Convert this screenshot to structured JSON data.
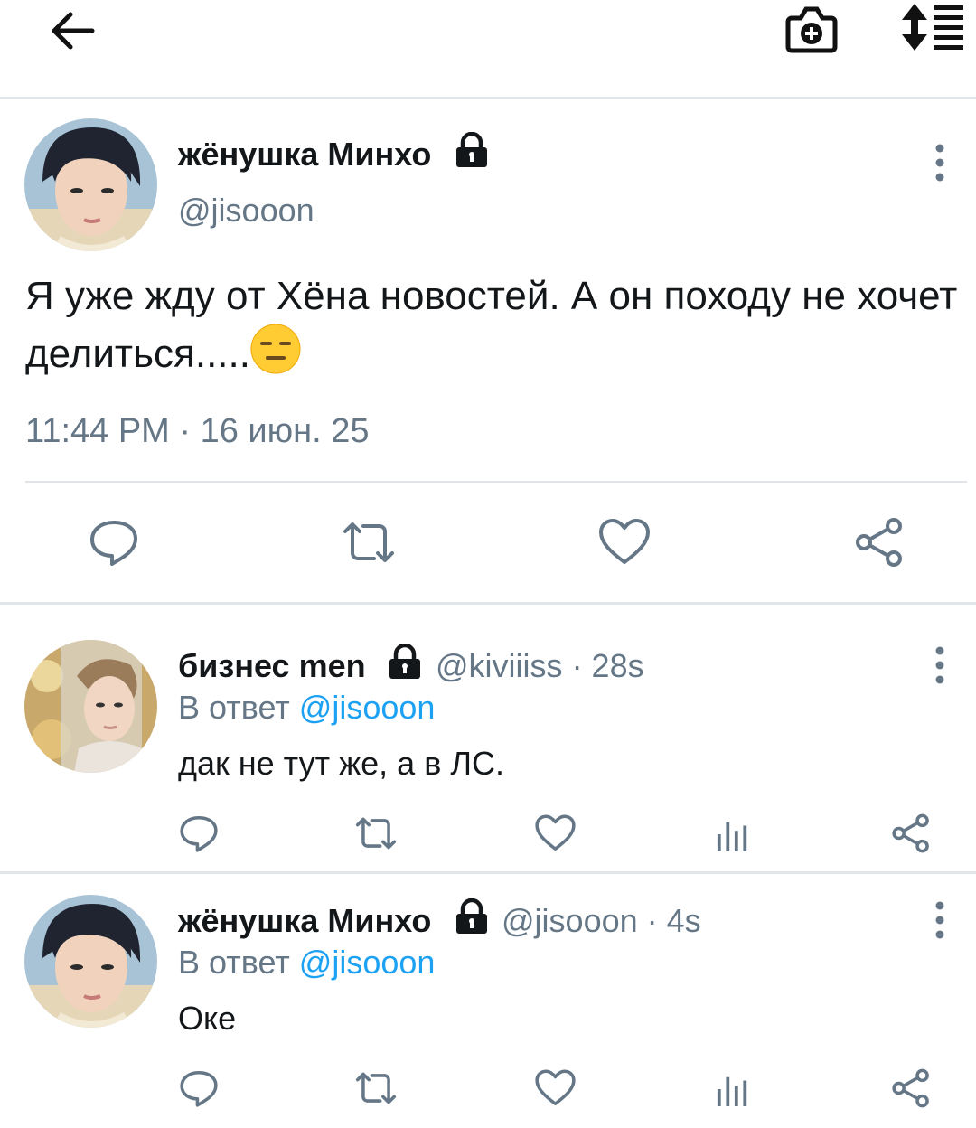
{
  "main_tweet": {
    "author_name": "жёнушка Минхо",
    "author_handle": "@jisooon",
    "text": "Я уже жду от Хёна новостей. А он походу не хочет делиться.....",
    "emoji": "expressionless-face",
    "timestamp": "11:44 PM · 16 июн. 25"
  },
  "replies": [
    {
      "author_name": "бизнес men",
      "author_handle": "@kiviiiss",
      "age": "· 28s",
      "reply_to_label": "В ответ",
      "reply_to_handle": "@jisooon",
      "text": "дак не тут же, а в ЛС."
    },
    {
      "author_name": "жёнушка Минхо",
      "author_handle": "@jisooon",
      "age": "· 4s",
      "reply_to_label": "В ответ",
      "reply_to_handle": "@jisooon",
      "text": "Оке"
    }
  ],
  "colors": {
    "accent": "#1da1f2",
    "text": "#14171a",
    "secondary": "#657786",
    "divider": "#e1e4e8"
  },
  "icons": [
    "back-arrow-icon",
    "add-photo-icon",
    "sort-icon",
    "lock-icon",
    "more-vertical-icon",
    "reply-icon",
    "retweet-icon",
    "like-icon",
    "share-icon",
    "analytics-icon"
  ]
}
